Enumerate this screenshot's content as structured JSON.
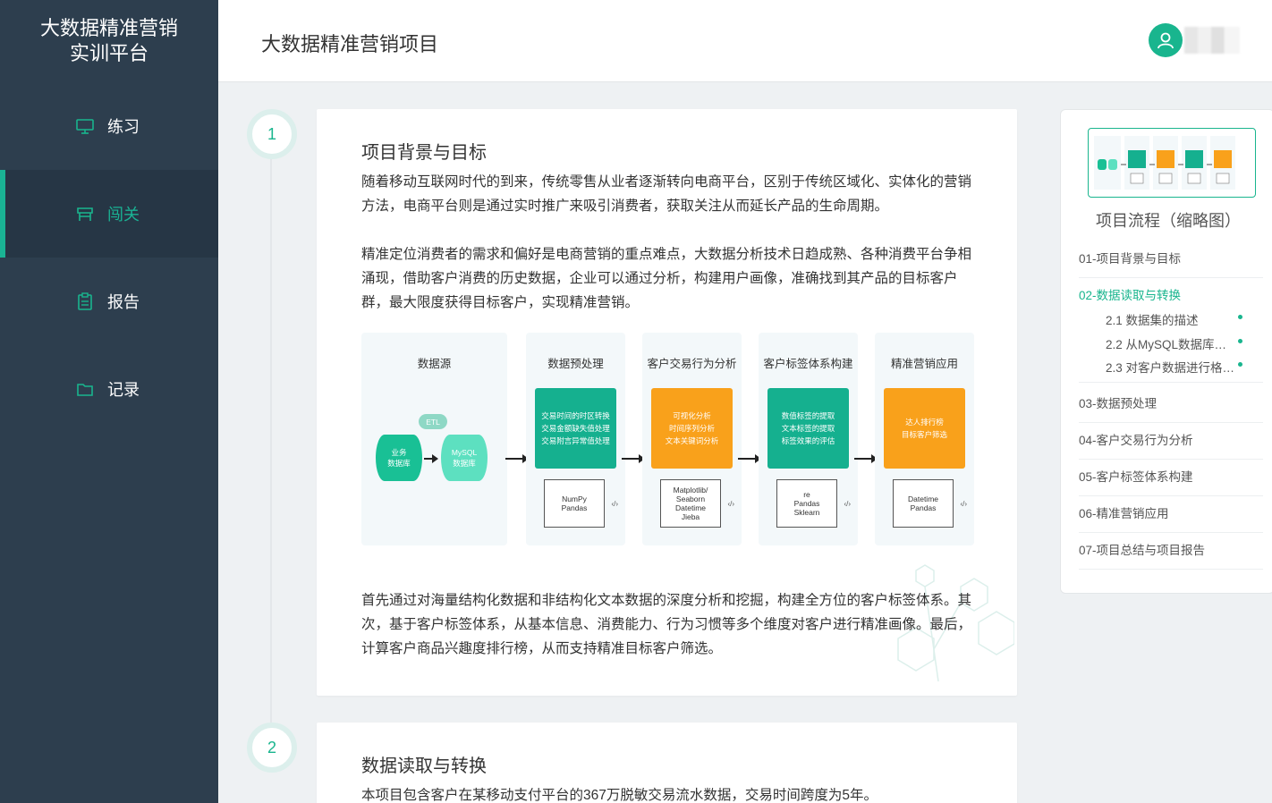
{
  "sidebar": {
    "brand_line1": "大数据精准营销",
    "brand_line2": "实训平台",
    "items": [
      {
        "label": "练习"
      },
      {
        "label": "闯关"
      },
      {
        "label": "报告"
      },
      {
        "label": "记录"
      }
    ],
    "active_index": 1
  },
  "header": {
    "title": "大数据精准营销项目"
  },
  "steps": [
    {
      "number": "1",
      "title": "项目背景与目标",
      "para1": "随着移动互联网时代的到来，传统零售从业者逐渐转向电商平台，区别于传统区域化、实体化的营销方法，电商平台则是通过实时推广来吸引消费者，获取关注从而延长产品的生命周期。",
      "para2": "精准定位消费者的需求和偏好是电商营销的重点难点，大数据分析技术日趋成熟、各种消费平台争相涌现，借助客户消费的历史数据，企业可以通过分析，构建用户画像，准确找到其产品的目标客户群，最大限度获得目标客户，实现精准营销。",
      "para3": "首先通过对海量结构化数据和非结构化文本数据的深度分析和挖掘，构建全方位的客户标签体系。其次，基于客户标签体系，从基本信息、消费能力、行为习惯等多个维度对客户进行精准画像。最后，计算客户商品兴趣度排行榜，从而支持精准目标客户筛选。"
    },
    {
      "number": "2",
      "title": "数据读取与转换",
      "para1": "本项目包含客户在某移动支付平台的367万脱敏交易流水数据，交易时间跨度为5年。"
    }
  ],
  "diagram": {
    "source": {
      "title": "数据源",
      "db1": "业务\n数据库",
      "etl": "ETL",
      "db2": "MySQL\n数据库"
    },
    "stages": [
      {
        "title": "数据预处理",
        "color": "#15b08f",
        "lines": [
          "交易时间的时区转换",
          "交易金额缺失值处理",
          "交易附言异常值处理"
        ],
        "tools": [
          "NumPy",
          "Pandas"
        ]
      },
      {
        "title": "客户交易行为分析",
        "color": "#f9a11b",
        "lines": [
          "可视化分析",
          "时间序列分析",
          "文本关键词分析"
        ],
        "tools": [
          "Matplotlib/",
          "Seaborn",
          "Datetime",
          "Jieba"
        ]
      },
      {
        "title": "客户标签体系构建",
        "color": "#15b08f",
        "lines": [
          "数值标签的提取",
          "文本标签的提取",
          "标签效果的评估"
        ],
        "tools": [
          "re",
          "Pandas",
          "Sklearn"
        ]
      },
      {
        "title": "精准营销应用",
        "color": "#f9a11b",
        "lines": [
          "达人排行榜",
          "目标客户筛选"
        ],
        "tools": [
          "Datetime",
          "Pandas"
        ]
      }
    ],
    "code_glyph": "‹/›"
  },
  "outline": {
    "title": "项目流程（缩略图）",
    "items": [
      {
        "label": "01-项目背景与目标"
      },
      {
        "label": "02-数据读取与转换"
      },
      {
        "label": "03-数据预处理"
      },
      {
        "label": "04-客户交易行为分析"
      },
      {
        "label": "05-客户标签体系构建"
      },
      {
        "label": "06-精准营销应用"
      },
      {
        "label": "07-项目总结与项目报告"
      }
    ],
    "subitems": [
      {
        "label": "2.1 数据集的描述"
      },
      {
        "label": "2.2 从MySQL数据库…"
      },
      {
        "label": "2.3 对客户数据进行格…"
      }
    ],
    "active_index": 1
  },
  "colors": {
    "accent": "#19b58e",
    "sidebar_bg": "#2d3e4e",
    "orange": "#f9a11b"
  }
}
